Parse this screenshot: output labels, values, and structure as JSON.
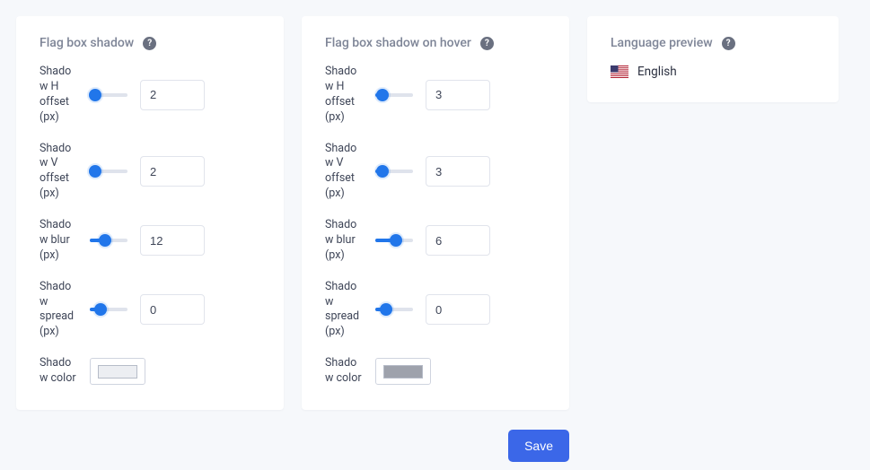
{
  "panels": {
    "normal": {
      "title": "Flag box shadow",
      "rows": {
        "h": {
          "label": "Shadow H offset (px)",
          "value": "2",
          "pos": 15
        },
        "v": {
          "label": "Shadow V offset (px)",
          "value": "2",
          "pos": 15
        },
        "blur": {
          "label": "Shadow blur (px)",
          "value": "12",
          "pos": 40
        },
        "spread": {
          "label": "Shadow spread (px)",
          "value": "0",
          "pos": 28
        },
        "color": {
          "label": "Shadow color",
          "swatch": "#eceef2"
        }
      }
    },
    "hover": {
      "title": "Flag box shadow on hover",
      "rows": {
        "h": {
          "label": "Shadow H offset (px)",
          "value": "3",
          "pos": 20
        },
        "v": {
          "label": "Shadow V offset (px)",
          "value": "3",
          "pos": 20
        },
        "blur": {
          "label": "Shadow blur (px)",
          "value": "6",
          "pos": 55
        },
        "spread": {
          "label": "Shadow spread (px)",
          "value": "0",
          "pos": 28
        },
        "color": {
          "label": "Shadow color",
          "swatch": "#9ea2ac"
        }
      }
    }
  },
  "preview": {
    "title": "Language preview",
    "language": "English"
  },
  "actions": {
    "save": "Save"
  }
}
